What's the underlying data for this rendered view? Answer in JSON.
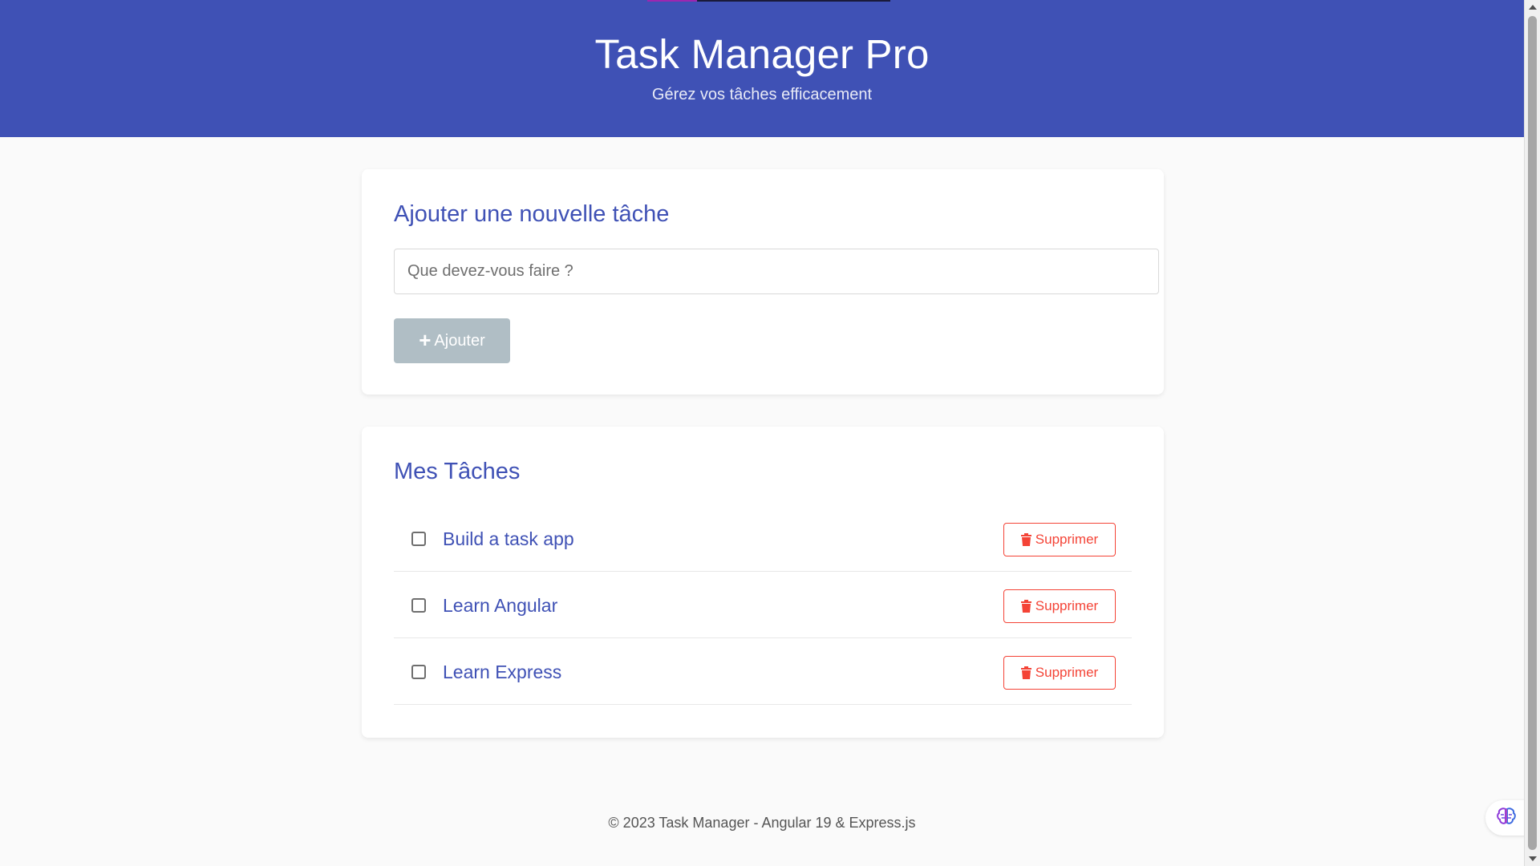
{
  "header": {
    "title": "Task Manager Pro",
    "subtitle": "Gérez vos tâches efficacement"
  },
  "add_card": {
    "title": "Ajouter une nouvelle tâche",
    "input_placeholder": "Que devez-vous faire ?",
    "input_value": "",
    "add_button_icon": "+",
    "add_button_label": "Ajouter"
  },
  "list_card": {
    "title": "Mes Tâches",
    "tasks": [
      {
        "label": "Build a task app",
        "done": false,
        "delete_label": "Supprimer"
      },
      {
        "label": "Learn Angular",
        "done": false,
        "delete_label": "Supprimer"
      },
      {
        "label": "Learn Express",
        "done": false,
        "delete_label": "Supprimer"
      }
    ]
  },
  "footer": {
    "text": "© 2023 Task Manager - Angular 19 & Express.js"
  },
  "icons": {
    "add": "plus-icon",
    "delete": "trash-icon",
    "widget": "brain-icon"
  },
  "colors": {
    "primary": "#3f51b5",
    "danger": "#f44336",
    "disabled_button": "#b0bec5",
    "background": "#fafafa"
  }
}
